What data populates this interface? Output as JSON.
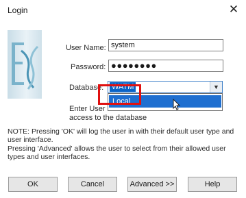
{
  "window": {
    "title": "Login",
    "close_glyph": "✕"
  },
  "form": {
    "username_label": "User Name:",
    "username_value": "system",
    "password_label": "Password:",
    "password_value": "●●●●●●●●",
    "database_label": "Database:",
    "database_selected": "WATM",
    "dropdown_option": "Local",
    "hint_line1": "Enter User N",
    "hint_line2": "access to the database"
  },
  "notes": {
    "line1": "NOTE:  Pressing 'OK' will log the user in with their default user type and",
    "line2": "user interface.",
    "line3": "Pressing 'Advanced' allows the user to select from their allowed user",
    "line4": "types and user interfaces."
  },
  "buttons": {
    "ok": "OK",
    "cancel": "Cancel",
    "advanced": "Advanced >>",
    "help": "Help"
  },
  "colors": {
    "highlight_box": "#e01010",
    "selection": "#1f6fd0"
  }
}
